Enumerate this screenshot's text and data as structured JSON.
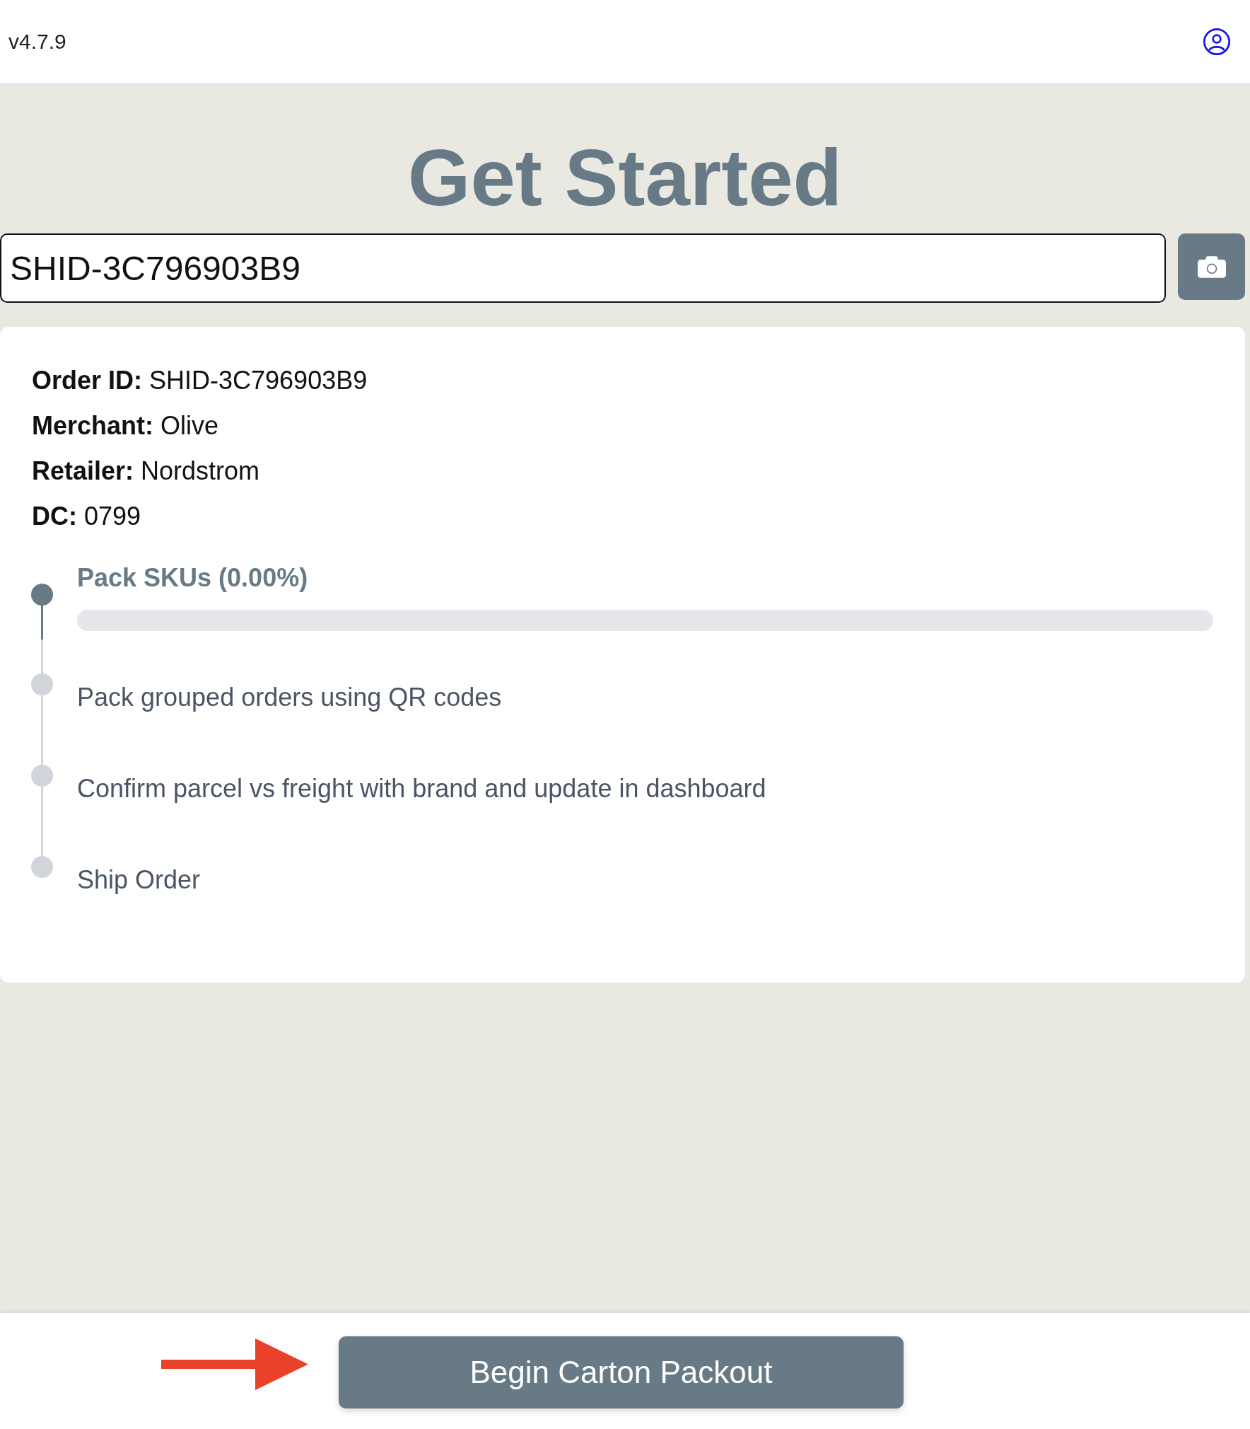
{
  "header": {
    "version": "v4.7.9"
  },
  "title": "Get Started",
  "order_search": {
    "value": "SHID-3C796903B9"
  },
  "order_details": [
    {
      "label": "Order ID:",
      "value": "SHID-3C796903B9"
    },
    {
      "label": "Merchant:",
      "value": "Olive"
    },
    {
      "label": "Retailer:",
      "value": "Nordstrom"
    },
    {
      "label": "DC:",
      "value": "0799"
    }
  ],
  "steps": [
    {
      "label": "Pack SKUs (0.00%)",
      "active": true,
      "progress": {
        "level": 0
      }
    },
    {
      "label": "Pack grouped orders using QR codes",
      "active": false
    },
    {
      "label": "Confirm parcel vs freight with brand and update in dashboard",
      "active": false
    },
    {
      "label": "Ship Order",
      "active": false
    }
  ],
  "footer": {
    "primary_button": "Begin Carton Packout"
  }
}
